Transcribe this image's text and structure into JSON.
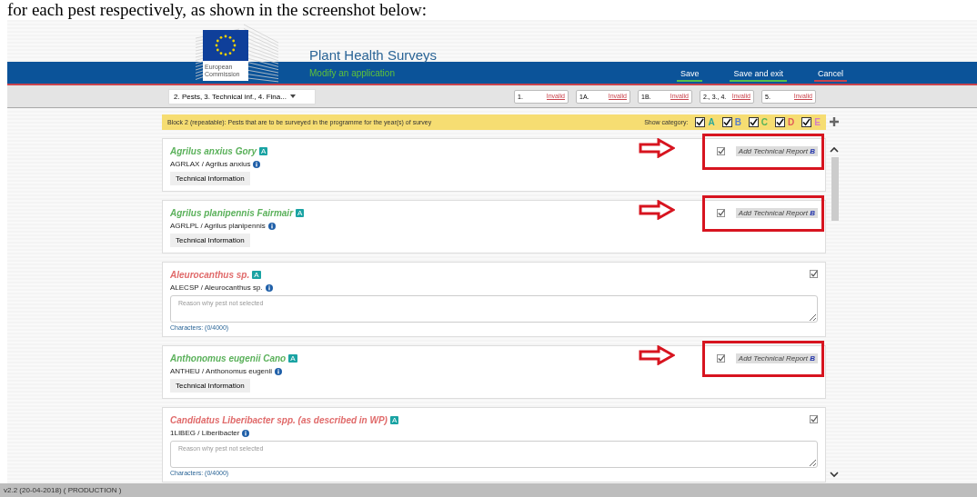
{
  "caption": "for each pest respectively, as shown in the screenshot below:",
  "header": {
    "logo_text": [
      "European",
      "Commission"
    ],
    "title": "Plant Health Surveys",
    "subtitle": "Modify an application",
    "actions": [
      {
        "label": "Save",
        "kind": "confirm"
      },
      {
        "label": "Save and exit",
        "kind": "confirm"
      },
      {
        "label": "Cancel",
        "kind": "cancel"
      }
    ]
  },
  "toolbar": {
    "section_select": "2. Pests, 3. Technical inf., 4. Fina...",
    "validations": [
      {
        "label": "1.",
        "status": "Invalid"
      },
      {
        "label": "1A.",
        "status": "Invalid"
      },
      {
        "label": "1B.",
        "status": "Invalid"
      },
      {
        "label": "2., 3., 4.",
        "status": "Invalid"
      },
      {
        "label": "5.",
        "status": "Invalid"
      }
    ]
  },
  "block": {
    "title": "Block 2 (repeatable): Pests that are to be surveyed in the programme for the year(s) of survey",
    "filter_label": "Show category:",
    "categories": [
      {
        "label": "A",
        "checked": true,
        "color": "#2aa89a"
      },
      {
        "label": "B",
        "checked": true,
        "color": "#5b7fc9"
      },
      {
        "label": "C",
        "checked": true,
        "color": "#58b45a"
      },
      {
        "label": "D",
        "checked": true,
        "color": "#e05a5a"
      },
      {
        "label": "E",
        "checked": true,
        "color": "#d47fc0"
      }
    ]
  },
  "pests": [
    {
      "kind": "selected",
      "name": "Agrilus anxius Gory",
      "category": "A",
      "code": "AGRLAX / Agrilus anxius",
      "action": "Technical Information",
      "checked": true,
      "report_button": "Add Technical Report",
      "report_badge": "B",
      "highlighted": true
    },
    {
      "kind": "selected",
      "name": "Agrilus planipennis Fairmair",
      "category": "A",
      "code": "AGRLPL / Agrilus planipennis",
      "action": "Technical Information",
      "checked": true,
      "report_button": "Add Technical Report",
      "report_badge": "B",
      "highlighted": true
    },
    {
      "kind": "not_selected",
      "name": "Aleurocanthus sp.",
      "category": "A",
      "code": "ALECSP / Aleurocanthus sp.",
      "checked": true,
      "placeholder": "Reason why pest not selected",
      "counter": "Characters: (0/4000)",
      "highlighted": false
    },
    {
      "kind": "selected",
      "name": "Anthonomus eugenii Cano",
      "category": "A",
      "code": "ANTHEU / Anthonomus eugenii",
      "action": "Technical Information",
      "checked": true,
      "report_button": "Add Technical Report",
      "report_badge": "B",
      "highlighted": true
    },
    {
      "kind": "not_selected",
      "name": "Candidatus Liberibacter spp. (as described in WP)",
      "category": "A",
      "code": "1LIBEG / Liberibacter",
      "checked": true,
      "placeholder": "Reason why pest not selected",
      "counter": "Characters: (0/4000)",
      "highlighted": false
    }
  ],
  "status_bar": "v2.2 (20-04-2018) ( PRODUCTION )"
}
